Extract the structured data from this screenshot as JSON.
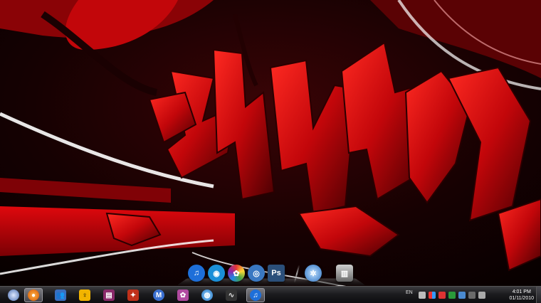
{
  "wallpaper": {
    "theme": "red-graffiti",
    "colors": {
      "primary": "#c0060b",
      "dark": "#120203",
      "highlight": "#ffffff"
    }
  },
  "dock": {
    "items": [
      {
        "name": "itunes-icon",
        "glyph": "♫",
        "color": "#1e6fd9"
      },
      {
        "name": "browser-icon",
        "glyph": "◉",
        "color": "#1b8fd8"
      },
      {
        "name": "picasa-icon",
        "glyph": "✿",
        "color": "#d44d2a"
      },
      {
        "name": "orbit-icon",
        "glyph": "◎",
        "color": "#3a78c2"
      },
      {
        "name": "photoshop-icon",
        "glyph": "Ps",
        "color": "#2b4f7a"
      },
      {
        "name": "aperture-icon",
        "glyph": "✲",
        "color": "#5a8fc8"
      },
      {
        "name": "trash-icon",
        "glyph": "▥",
        "color": "#8a8a8a"
      }
    ]
  },
  "taskbar": {
    "apps": [
      {
        "name": "start-orb-icon",
        "glyph": "",
        "color": "#6a8fd0"
      },
      {
        "name": "firefox-icon",
        "glyph": "●",
        "color": "#e06a12",
        "active": true
      },
      {
        "name": "contacts-icon",
        "glyph": "👥",
        "color": "#3a6fc0"
      },
      {
        "name": "aim-icon",
        "glyph": "♀",
        "color": "#f2b400"
      },
      {
        "name": "winrar-icon",
        "glyph": "▤",
        "color": "#8a2a6a"
      },
      {
        "name": "crystal-icon",
        "glyph": "✦",
        "color": "#c0301a"
      },
      {
        "name": "maxthon-icon",
        "glyph": "M",
        "color": "#3a6fd0"
      },
      {
        "name": "app-icon",
        "glyph": "✿",
        "color": "#b04aa0"
      },
      {
        "name": "globe-icon",
        "glyph": "◍",
        "color": "#2a8fe0"
      },
      {
        "name": "pulse-icon",
        "glyph": "∿",
        "color": "#555555"
      },
      {
        "name": "itunes-taskbar-icon",
        "glyph": "♫",
        "color": "#1e6fd9",
        "active": true
      }
    ],
    "tray": {
      "language": "EN",
      "time": "4:01 PM",
      "date": "01/11/2010"
    }
  }
}
